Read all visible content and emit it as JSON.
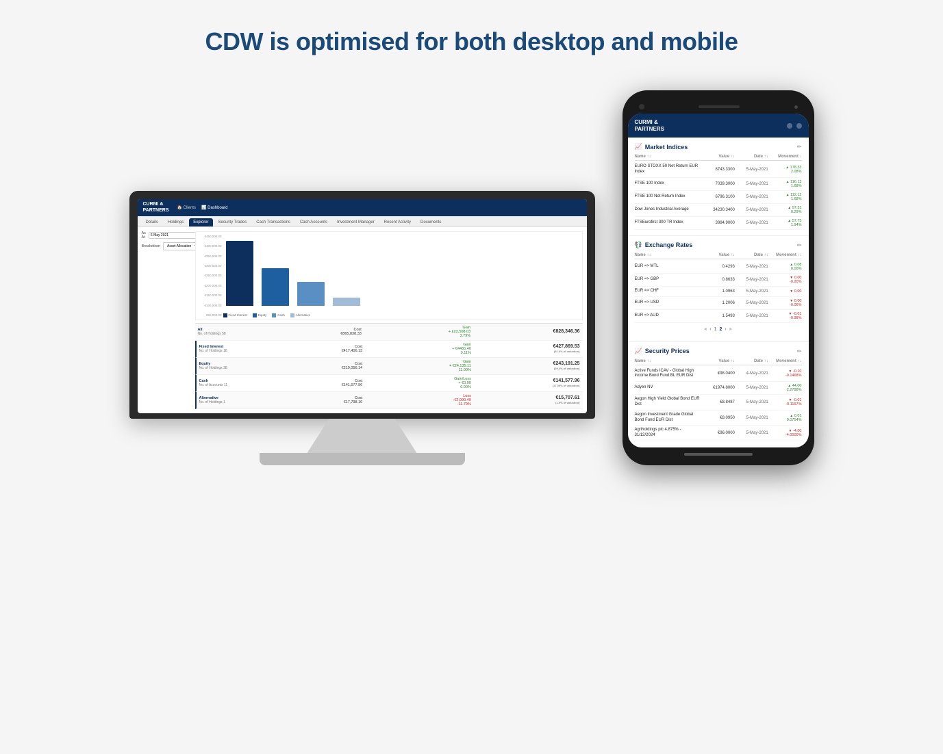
{
  "page": {
    "title": "CDW is optimised for both desktop and mobile"
  },
  "desktop": {
    "logo_line1": "CURMI &",
    "logo_line2": "PARTNERS",
    "nav_items": [
      "Clients",
      "Dashboard"
    ],
    "tabs": [
      "Details",
      "Holdings",
      "Explorer",
      "Security Trades",
      "Cash Transactions",
      "Cash Accounts",
      "Investment Manager",
      "Recent Activity",
      "Documents"
    ],
    "active_tab": "Explorer",
    "filter_label_as_at": "As At",
    "filter_date": "6 May 2021",
    "filter_label_breakdown": "Breakdown",
    "filter_breakdown": "Asset Allocation",
    "chart_y_labels": [
      "€450,000.00",
      "€400,000.00",
      "€350,000.00",
      "€300,000.00",
      "€250,000.00",
      "€200,000.00",
      "€150,000.00",
      "€100,000.00",
      "€50,000.00"
    ],
    "legend": [
      {
        "label": "Fixed Interest",
        "color": "#0d2f5e"
      },
      {
        "label": "Equity",
        "color": "#1e5fa0"
      },
      {
        "label": "Cash",
        "color": "#5a8fc4"
      },
      {
        "label": "Alternative",
        "color": "#a0bcd8"
      }
    ],
    "table": {
      "rows": [
        {
          "label": "All",
          "sub": "",
          "holdings_label": "No. of Holdings",
          "holdings": "58",
          "cost_label": "Cost",
          "cost": "€865,838.33",
          "gain_label": "Gain",
          "gain": "+ £22,508.03",
          "gain_pct": "3.79%",
          "total": "€828,346.36",
          "total_note": ""
        },
        {
          "label": "Fixed Interest",
          "sub": "",
          "holdings_label": "No. of Holdings",
          "holdings": "18",
          "cost_label": "Cost",
          "cost": "€417,406.13",
          "gain_label": "Gain",
          "gain": "+ €4465.40",
          "gain_pct": "0.11%",
          "total": "€427,869.53",
          "total_note": "(51.6% of valuation)"
        },
        {
          "label": "Equity",
          "sub": "",
          "holdings_label": "No. of Holdings",
          "holdings": "28",
          "cost_label": "Cost",
          "cost": "€219,056.14",
          "gain_label": "Gain",
          "gain": "+ €24,135.11",
          "gain_pct": "11.00%",
          "total": "€243,191.25",
          "total_note": "(29.4% of valuation)"
        },
        {
          "label": "Cash",
          "sub": "",
          "holdings_label": "No. of Accounts",
          "holdings": "11",
          "cost_label": "Cost",
          "cost": "€141,577.96",
          "gain_label": "Gain/Loss",
          "gain": "+ €0.00",
          "gain_pct": "0.00%",
          "total": "€141,577.96",
          "total_note": "(17.09% of valuation)"
        },
        {
          "label": "Alternative",
          "sub": "",
          "holdings_label": "No. of Holdings",
          "holdings": "1",
          "cost_label": "Cost",
          "cost": "€17,798.10",
          "gain_label": "Loss",
          "gain": "-€2,090.49",
          "gain_pct": "-11.79%",
          "total": "€15,707.61",
          "total_note": "(1.9% of valuation)"
        }
      ]
    }
  },
  "mobile": {
    "logo_line1": "CURMI &",
    "logo_line2": "PARTNERS",
    "market_indices": {
      "section_title": "Market Indices",
      "columns": [
        "Name ↑↓",
        "Value ↑↓",
        "Date ↑↓",
        "Movement ↓"
      ],
      "rows": [
        {
          "name": "EURO STOXX 50 Net Return EUR Index",
          "value": "8743.3300",
          "date": "5-May-2021",
          "movement": "+178.33",
          "movement_pct": "2.08%",
          "direction": "up"
        },
        {
          "name": "FTSE 100 Index",
          "value": "7039.3000",
          "date": "5-May-2021",
          "movement": "+116.13",
          "movement_pct": "1.68%",
          "direction": "up"
        },
        {
          "name": "FTSE 100 Net Return Index",
          "value": "6796.3100",
          "date": "5-May-2021",
          "movement": "+112.12",
          "movement_pct": "1.68%",
          "direction": "up"
        },
        {
          "name": "Dow Jones Industrial Average",
          "value": "34230.3400",
          "date": "5-May-2021",
          "movement": "+97.31",
          "movement_pct": "0.29%",
          "direction": "up"
        },
        {
          "name": "FTSEurofirst 300 TR Index",
          "value": "3984.9000",
          "date": "5-May-2021",
          "movement": "+57.75",
          "movement_pct": "1.94%",
          "direction": "up"
        }
      ]
    },
    "exchange_rates": {
      "section_title": "Exchange Rates",
      "columns": [
        "Name ↑↓",
        "Value ↑↓",
        "Date ↑↓",
        "Movement ↑↓"
      ],
      "rows": [
        {
          "name": "EUR => MTL",
          "value": "0.4293",
          "date": "5-May-2021",
          "movement": "0.08",
          "movement_pct": "0.00%",
          "direction": "up"
        },
        {
          "name": "EUR => GBP",
          "value": "0.8633",
          "date": "5-May-2021",
          "movement": "-0.00",
          "movement_pct": "-0.20%",
          "direction": "down"
        },
        {
          "name": "EUR => CHF",
          "value": "1.0963",
          "date": "5-May-2021",
          "movement": "0.00",
          "movement_pct": "",
          "direction": "down"
        },
        {
          "name": "EUR => USD",
          "value": "1.2006",
          "date": "5-May-2021",
          "movement": "0.00",
          "movement_pct": "-0.06%",
          "direction": "down"
        },
        {
          "name": "EUR => AUD",
          "value": "1.5493",
          "date": "5-May-2021",
          "movement": "-0.01",
          "movement_pct": "-0.98%",
          "direction": "down"
        }
      ],
      "pagination": [
        "«",
        "‹",
        "1",
        "2",
        "›",
        "»"
      ]
    },
    "security": {
      "section_title": "Security Prices",
      "columns": [
        "Name ↑↓",
        "Value ↑↓",
        "Date ↑↓",
        "Movement ↑↓"
      ],
      "rows": [
        {
          "name": "Active Funds ICAV - Global High Income Bond Fund BL EUR Dist",
          "value": "€98.0400",
          "date": "4-May-2021",
          "movement": "-0.10",
          "movement_pct": "-0.1468%",
          "direction": "down"
        },
        {
          "name": "Adyen NV",
          "value": "€1974.8000",
          "date": "5-May-2021",
          "movement": "44.00",
          "movement_pct": "2.2788%",
          "direction": "up"
        },
        {
          "name": "Aegon High Yield Global Bond EUR Dist",
          "value": "€8.8487",
          "date": "5-May-2021",
          "movement": "-0.01",
          "movement_pct": "-0.1167%",
          "direction": "down"
        },
        {
          "name": "Aegon Investment Grade Global Bond Fund EUR Dist",
          "value": "€8.0950",
          "date": "5-May-2021",
          "movement": "0.01",
          "movement_pct": "0.0754%",
          "direction": "up"
        },
        {
          "name": "Agriholdings plc 4.875% - 31/12/2024",
          "value": "€96.0000",
          "date": "5-May-2021",
          "movement": "-4.00",
          "movement_pct": "-4.0000%",
          "direction": "down"
        }
      ]
    }
  }
}
